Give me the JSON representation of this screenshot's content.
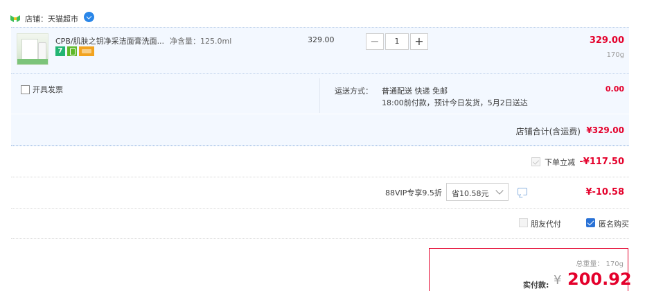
{
  "store": {
    "name": "店铺：天猫超市"
  },
  "item": {
    "title": "CPB/肌肤之钥净采洁面膏洗面...",
    "spec": "净含量：125.0ml",
    "unit_price": "329.00",
    "quantity": "1",
    "minus": "−",
    "plus": "+",
    "subtotal": "329.00",
    "weight": "170g",
    "tag_seven": "7"
  },
  "delivery": {
    "invoice_label": "开具发票",
    "ship_label": "运送方式：",
    "ship_method": "普通配送 快递 免邮",
    "ship_eta": "18:00前付款，预计今日发货，5月2日送达",
    "ship_fee": "0.00"
  },
  "store_total": {
    "label": "店铺合计(含运费)",
    "value": "¥329.00"
  },
  "discounts": {
    "instant_label": "下单立减",
    "instant_value": "-¥117.50",
    "vip_label": "88VIP专享9.5折",
    "vip_select": "省10.58元",
    "vip_value": "¥-10.58"
  },
  "options": {
    "friend_pay": "朋友代付",
    "anonymous": "匿名购买"
  },
  "summary": {
    "total_weight": "总重量：  170g",
    "pay_label": "实付款:",
    "currency": "¥",
    "amount": "200.92"
  },
  "colors": {
    "accent": "#e4002b",
    "row_bg": "#f3f8ff",
    "checkbox_checked": "#2a72d6"
  }
}
